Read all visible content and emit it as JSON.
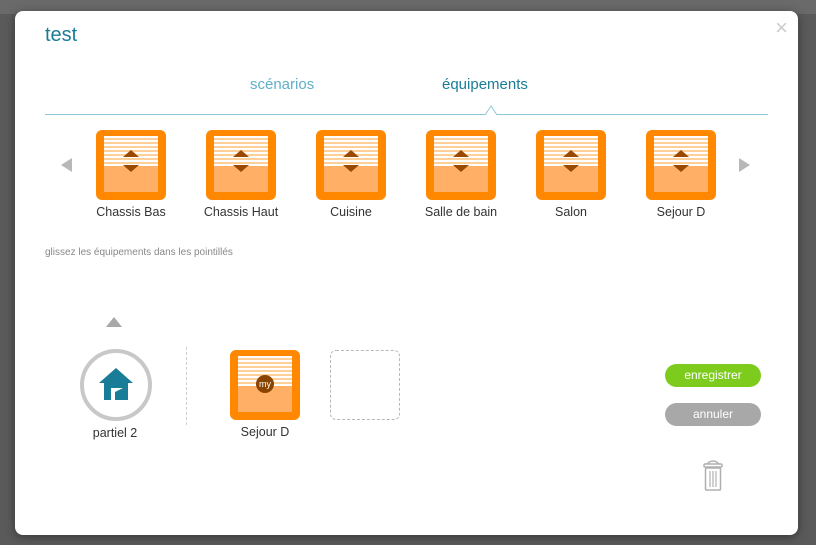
{
  "modal": {
    "title": "test",
    "close_glyph": "×"
  },
  "tabs": [
    {
      "label": "scénarios",
      "active": false
    },
    {
      "label": "équipements",
      "active": true
    }
  ],
  "equipment_list": [
    {
      "label": "Chassis Bas",
      "icon": "blind-icon"
    },
    {
      "label": "Chassis Haut",
      "icon": "blind-icon"
    },
    {
      "label": "Cuisine",
      "icon": "blind-icon"
    },
    {
      "label": "Salle de bain",
      "icon": "blind-icon"
    },
    {
      "label": "Salon",
      "icon": "blind-icon"
    },
    {
      "label": "Sejour D",
      "icon": "blind-icon"
    }
  ],
  "hint": "glissez les équipements dans les pointillés",
  "scenario": {
    "label": "partiel 2",
    "icon": "house-icon"
  },
  "placed_equipment": [
    {
      "label": "Sejour D",
      "badge": "my",
      "icon": "blind-my-icon"
    }
  ],
  "buttons": {
    "save": "enregistrer",
    "cancel": "annuler"
  },
  "colors": {
    "accent": "#1a7d97",
    "tile_orange": "#ff8800",
    "save_green": "#7dcc1d",
    "cancel_gray": "#a8a8a8"
  }
}
